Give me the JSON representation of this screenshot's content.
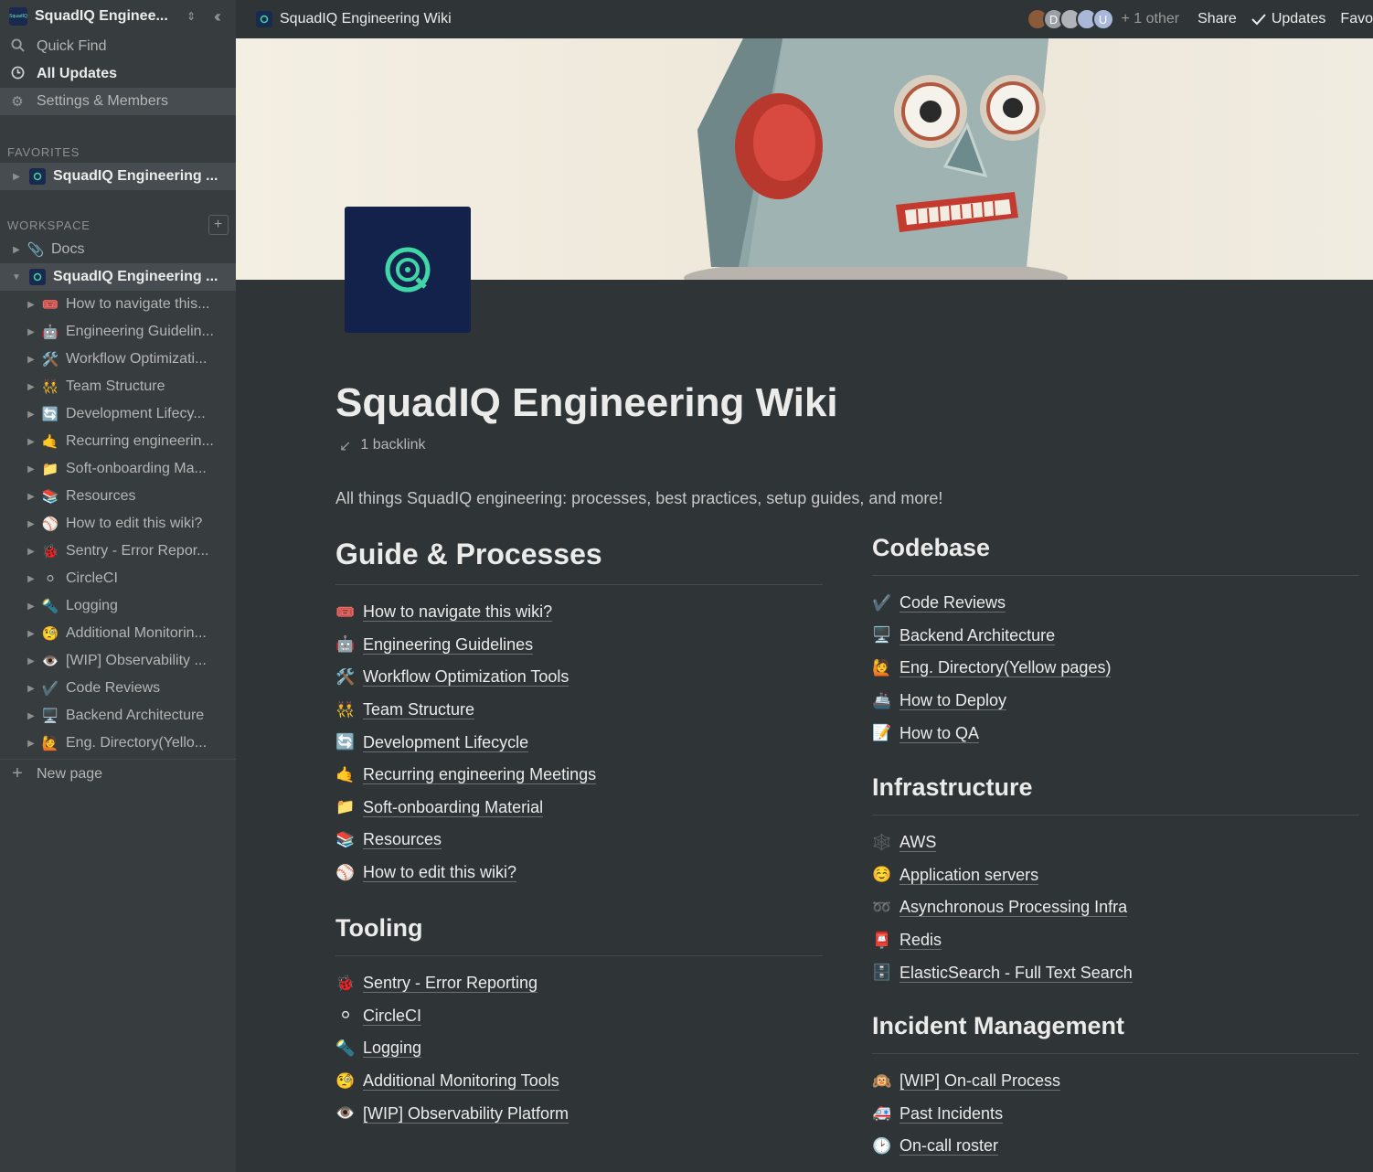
{
  "sidebar": {
    "workspace_name": "SquadIQ Enginee...",
    "logo_text": "SquadIQ",
    "nav": [
      {
        "icon": "search-icon",
        "label": "Quick Find"
      },
      {
        "icon": "clock-icon",
        "label": "All Updates"
      },
      {
        "icon": "gear-icon",
        "label": "Settings & Members"
      }
    ],
    "favorites_label": "FAVORITES",
    "favorites": [
      {
        "label": "SquadIQ Engineering ..."
      }
    ],
    "workspace_label": "WORKSPACE",
    "docs": {
      "emoji": "📎",
      "label": "Docs"
    },
    "root": {
      "label": "SquadIQ Engineering ..."
    },
    "children": [
      {
        "emoji": "🎟️",
        "label": "How to navigate this..."
      },
      {
        "emoji": "🤖",
        "label": "Engineering Guidelin..."
      },
      {
        "emoji": "🛠️",
        "label": "Workflow Optimizati..."
      },
      {
        "emoji": "👯",
        "label": "Team Structure"
      },
      {
        "emoji": "🔄",
        "label": "Development Lifecy..."
      },
      {
        "emoji": "🤙",
        "label": "Recurring engineerin..."
      },
      {
        "emoji": "📁",
        "label": "Soft-onboarding Ma..."
      },
      {
        "emoji": "📚",
        "label": "Resources"
      },
      {
        "emoji": "⚾",
        "label": "How to edit this wiki?"
      },
      {
        "emoji": "🐞",
        "label": "Sentry - Error Repor..."
      },
      {
        "emoji": "⚪",
        "label": "CircleCI"
      },
      {
        "emoji": "🔦",
        "label": "Logging"
      },
      {
        "emoji": "🧐",
        "label": "Additional Monitorin..."
      },
      {
        "emoji": "👁️",
        "label": "[WIP] Observability ..."
      },
      {
        "emoji": "✔️",
        "label": "Code Reviews"
      },
      {
        "emoji": "🖥️",
        "label": "Backend Architecture"
      },
      {
        "emoji": "🙋",
        "label": "Eng. Directory(Yello..."
      }
    ],
    "new_page_label": "New page"
  },
  "topbar": {
    "breadcrumb": "SquadIQ Engineering Wiki",
    "avatars": [
      {
        "letter": "",
        "color": "#8a5a3a"
      },
      {
        "letter": "D",
        "color": "#9aa0a6"
      },
      {
        "letter": "",
        "color": "#b0b4b8"
      },
      {
        "letter": "",
        "color": "#a9b8d8"
      },
      {
        "letter": "U",
        "color": "#a9b8d8"
      }
    ],
    "others": "+ 1 other",
    "share": "Share",
    "updates": "Updates",
    "favorite": "Favo"
  },
  "page": {
    "title": "SquadIQ Engineering Wiki",
    "backlink": "1 backlink",
    "description": "All things SquadIQ engineering: processes, best practices, setup guides, and more!"
  },
  "sections": {
    "guide": {
      "heading": "Guide & Processes",
      "links": [
        {
          "emoji": "🎟️",
          "label": "How to navigate this wiki?"
        },
        {
          "emoji": "🤖",
          "label": "Engineering Guidelines"
        },
        {
          "emoji": "🛠️",
          "label": "Workflow Optimization Tools"
        },
        {
          "emoji": "👯",
          "label": "Team Structure"
        },
        {
          "emoji": "🔄",
          "label": "Development Lifecycle"
        },
        {
          "emoji": "🤙",
          "label": "Recurring engineering Meetings"
        },
        {
          "emoji": "📁",
          "label": "Soft-onboarding Material"
        },
        {
          "emoji": "📚",
          "label": "Resources"
        },
        {
          "emoji": "⚾",
          "label": "How to edit this wiki?"
        }
      ]
    },
    "tooling": {
      "heading": "Tooling",
      "links": [
        {
          "emoji": "🐞",
          "label": "Sentry - Error Reporting"
        },
        {
          "emoji": "⚪",
          "label": "CircleCI"
        },
        {
          "emoji": "🔦",
          "label": "Logging"
        },
        {
          "emoji": "🧐",
          "label": "Additional Monitoring Tools"
        },
        {
          "emoji": "👁️",
          "label": "[WIP] Observability Platform"
        }
      ]
    },
    "codebase": {
      "heading": "Codebase",
      "links": [
        {
          "emoji": "✔️",
          "label": "Code Reviews"
        },
        {
          "emoji": "🖥️",
          "label": "Backend Architecture"
        },
        {
          "emoji": "🙋",
          "label": "Eng. Directory(Yellow pages)"
        },
        {
          "emoji": "🚢",
          "label": "How to Deploy"
        },
        {
          "emoji": "📝",
          "label": "How to QA"
        }
      ]
    },
    "infrastructure": {
      "heading": "Infrastructure",
      "links": [
        {
          "emoji": "🕸️",
          "label": "AWS"
        },
        {
          "emoji": "☺️",
          "label": "Application servers"
        },
        {
          "emoji": "➿",
          "label": "Asynchronous Processing Infra"
        },
        {
          "emoji": "📮",
          "label": "Redis"
        },
        {
          "emoji": "🗄️",
          "label": "ElasticSearch - Full Text Search"
        }
      ]
    },
    "incident": {
      "heading": "Incident Management",
      "links": [
        {
          "emoji": "🙉",
          "label": "[WIP] On-call Process"
        },
        {
          "emoji": "🚑",
          "label": "Past Incidents"
        },
        {
          "emoji": "🕑",
          "label": "On-call roster"
        }
      ]
    }
  }
}
